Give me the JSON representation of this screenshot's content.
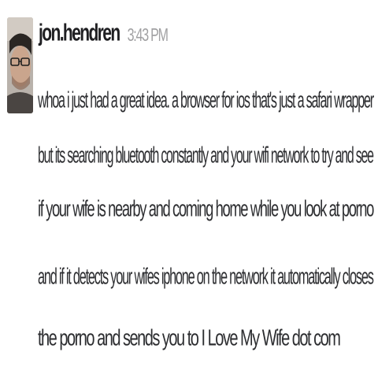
{
  "message": {
    "username": "jon.hendren",
    "timestamp": "3:43 PM",
    "lines": [
      "whoa i just had a great idea. a browser for ios that's just a safari wrapper",
      "but its searching bluetooth constantly and your wifi network to try and see",
      "if your wife is nearby and coming home while you look at porno",
      "and if it detects your wifes iphone on the network it automatically closes",
      "the porno and sends you to I Love My Wife dot com"
    ]
  }
}
